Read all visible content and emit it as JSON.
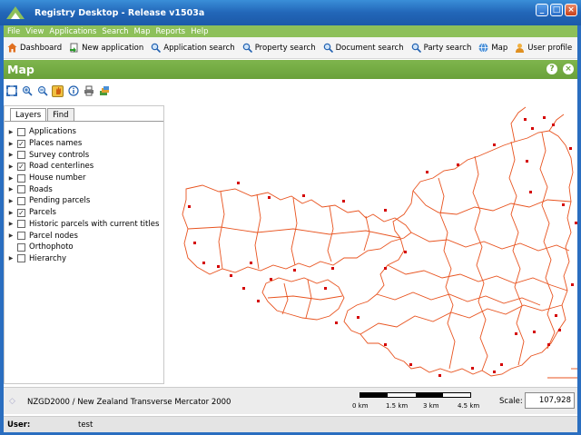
{
  "window": {
    "title": "Registry Desktop - Release v1503a"
  },
  "menu": [
    "File",
    "View",
    "Applications",
    "Search",
    "Map",
    "Reports",
    "Help"
  ],
  "toolbar": [
    {
      "label": "Dashboard",
      "icon": "home-icon"
    },
    {
      "label": "New application",
      "icon": "new-application-icon"
    },
    {
      "label": "Application search",
      "icon": "search-icon"
    },
    {
      "label": "Property search",
      "icon": "search-icon"
    },
    {
      "label": "Document search",
      "icon": "search-icon"
    },
    {
      "label": "Party search",
      "icon": "search-icon"
    },
    {
      "label": "Map",
      "icon": "globe-icon"
    },
    {
      "label": "User profile",
      "icon": "user-icon"
    }
  ],
  "panel": {
    "title": "Map",
    "help_icon": "?",
    "close_icon": "×"
  },
  "map_tools": [
    "full-extent-icon",
    "zoom-in-icon",
    "zoom-out-icon",
    "pan-icon",
    "info-icon",
    "print-icon",
    "layers-icon"
  ],
  "tabs": {
    "layers": "Layers",
    "find": "Find"
  },
  "layers": [
    {
      "label": "Applications",
      "checked": false,
      "expandable": true
    },
    {
      "label": "Places names",
      "checked": true,
      "expandable": true
    },
    {
      "label": "Survey controls",
      "checked": false,
      "expandable": true
    },
    {
      "label": "Road centerlines",
      "checked": true,
      "expandable": true
    },
    {
      "label": "House number",
      "checked": false,
      "expandable": true
    },
    {
      "label": "Roads",
      "checked": false,
      "expandable": true
    },
    {
      "label": "Pending parcels",
      "checked": false,
      "expandable": true
    },
    {
      "label": "Parcels",
      "checked": true,
      "expandable": true
    },
    {
      "label": "Historic parcels with current titles",
      "checked": false,
      "expandable": true
    },
    {
      "label": "Parcel nodes",
      "checked": false,
      "expandable": true
    },
    {
      "label": "Orthophoto",
      "checked": false,
      "expandable": false
    },
    {
      "label": "Hierarchy",
      "checked": false,
      "expandable": true
    }
  ],
  "status": {
    "crs": "NZGD2000 / New Zealand Transverse Mercator 2000",
    "scale_labels": [
      "0 km",
      "1.5 km",
      "3 km",
      "4.5 km"
    ],
    "scale_label": "Scale:",
    "scale_value": "107,928"
  },
  "user": {
    "label": "User:",
    "value": "test"
  },
  "colors": {
    "accent": "#7fb54d",
    "parcel": "#e8531f",
    "point": "#d40000"
  }
}
